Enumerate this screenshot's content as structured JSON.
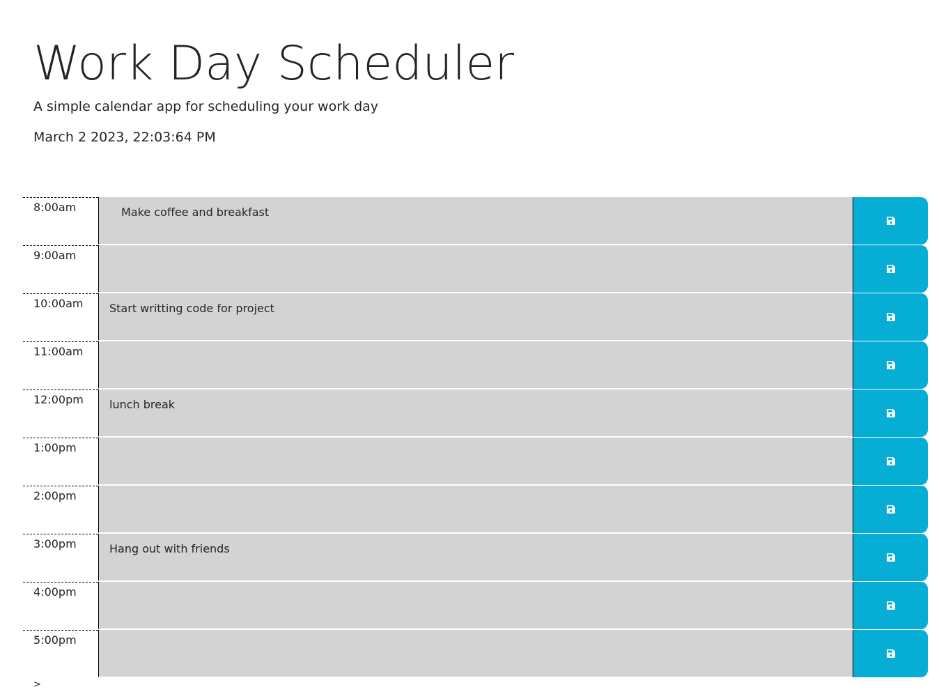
{
  "header": {
    "title": "Work Day Scheduler",
    "lead": "A simple calendar app for scheduling your work day",
    "current_day": "March 2 2023, 22:03:64 PM"
  },
  "colors": {
    "past": "#d3d3d3",
    "save_button": "#06aed5"
  },
  "rows": [
    {
      "hour": "8:00am",
      "text": "Make coffee and breakfast",
      "save_icon": "floppy-disk-icon"
    },
    {
      "hour": "9:00am",
      "text": "",
      "save_icon": "floppy-disk-icon"
    },
    {
      "hour": "10:00am",
      "text": "Start writting code for project",
      "save_icon": "floppy-disk-icon"
    },
    {
      "hour": "11:00am",
      "text": "",
      "save_icon": "floppy-disk-icon"
    },
    {
      "hour": "12:00pm",
      "text": "lunch break",
      "save_icon": "floppy-disk-icon"
    },
    {
      "hour": "1:00pm",
      "text": "",
      "save_icon": "floppy-disk-icon"
    },
    {
      "hour": "2:00pm",
      "text": "",
      "save_icon": "floppy-disk-icon"
    },
    {
      "hour": "3:00pm",
      "text": "Hang out with friends",
      "save_icon": "floppy-disk-icon"
    },
    {
      "hour": "4:00pm",
      "text": "",
      "save_icon": "floppy-disk-icon"
    },
    {
      "hour": "5:00pm",
      "text": "",
      "save_icon": "floppy-disk-icon"
    }
  ],
  "footer": {
    "caret": ">"
  }
}
